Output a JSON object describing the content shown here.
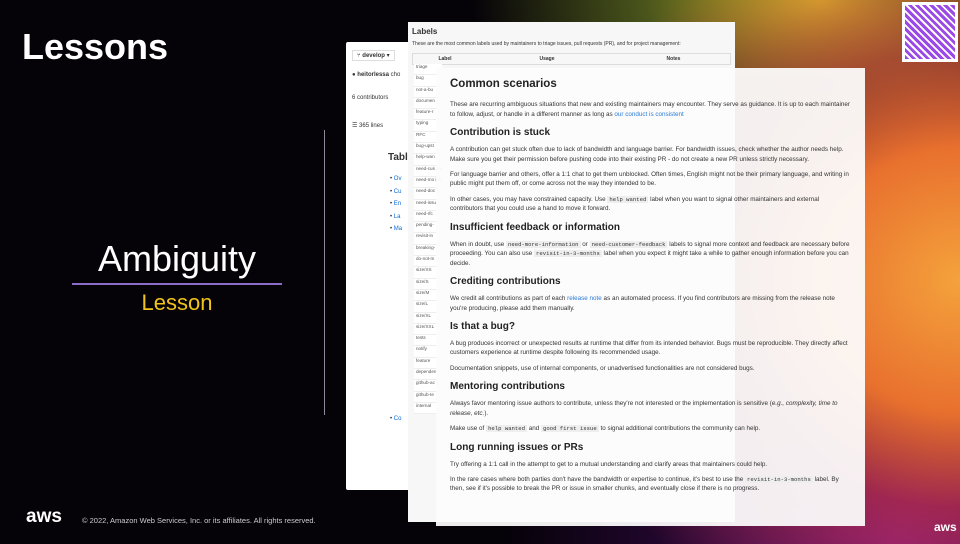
{
  "slide": {
    "title": "Lessons",
    "topic": "Ambiguity",
    "subtitle": "Lesson",
    "copyright": "© 2022, Amazon Web Services, Inc. or its affiliates. All rights reserved.",
    "aws_logo": "aws"
  },
  "github": {
    "branch": "develop",
    "author": "heitorlessa",
    "author_suffix": "cho",
    "contributors": "6 contributors",
    "lines": "365 lines",
    "toc_title": "Table",
    "toc_items": [
      "Ov",
      "Cu",
      "En",
      "La",
      "Ma",
      "Co"
    ]
  },
  "labels": {
    "title": "Labels",
    "intro": "These are the most common labels used by maintainers to triage issues, pull requests (PR), and for project management:",
    "columns": [
      "Label",
      "Usage",
      "Notes"
    ],
    "items": [
      "triage",
      "bug",
      "not-a-bu",
      "documen",
      "feature-r",
      "typing",
      "RFC",
      "bug-upst",
      "help-wan",
      "need-cus feedback",
      "need-mo informati",
      "need-doc",
      "need-issu",
      "need-rfc",
      "pending-",
      "revisit-in",
      "breaking-",
      "do-not-m",
      "size/XS",
      "size/S",
      "size/M",
      "size/L",
      "size/XL",
      "size/XXL",
      "tests",
      "notify",
      "feature",
      "dependen",
      "github-ac",
      "github-te",
      "internal"
    ]
  },
  "doc": {
    "h_common": "Common scenarios",
    "p_common": "These are recurring ambiguous situations that new and existing maintainers may encounter. They serve as guidance. It is up to each maintainer to follow, adjust, or handle in a different manner as long as ",
    "link_conduct": "our conduct is consistent",
    "h_stuck": "Contribution is stuck",
    "p_stuck1": "A contribution can get stuck often due to lack of bandwidth and language barrier. For bandwidth issues, check whether the author needs help. Make sure you get their permission before pushing code into their existing PR - do not create a new PR unless strictly necessary.",
    "p_stuck2": "For language barrier and others, offer a 1:1 chat to get them unblocked. Often times, English might not be their primary language, and writing in public might put them off, or come across not the way they intended to be.",
    "p_stuck3a": "In other cases, you may have constrained capacity. Use ",
    "code_help": "help wanted",
    "p_stuck3b": " label when you want to signal other maintainers and external contributors that you could use a hand to move it forward.",
    "h_feedback": "Insufficient feedback or information",
    "p_fb_a": "When in doubt, use ",
    "code_nmi": "need-more-information",
    "p_fb_b": " or ",
    "code_ncf": "need-customer-feedback",
    "p_fb_c": " labels to signal more context and feedback are necessary before proceeding. You can also use ",
    "code_revisit": "revisit-in-3-months",
    "p_fb_d": " label when you expect it might take a while to gather enough information before you can decide.",
    "h_credit": "Crediting contributions",
    "p_credit_a": "We credit all contributions as part of each ",
    "link_release": "release note",
    "p_credit_b": " as an automated process. If you find contributors are missing from the release note you're producing, please add them manually.",
    "h_bug": "Is that a bug?",
    "p_bug1": "A bug produces incorrect or unexpected results at runtime that differ from its intended behavior. Bugs must be reproducible. They directly affect customers experience at runtime despite following its recommended usage.",
    "p_bug2": "Documentation snippets, use of internal components, or unadvertised functionalities are not considered bugs.",
    "h_mentor": "Mentoring contributions",
    "p_mentor1a": "Always favor mentoring issue authors to contribute, unless they're not interested or the implementation is sensitive (",
    "p_mentor1_em": "e.g., complexity, time to release, etc.",
    "p_mentor1b": ").",
    "p_mentor2a": "Make use of ",
    "code_gfi": "good first issue",
    "p_mentor2b": " and ",
    "p_mentor2c": " to signal additional contributions the community can help.",
    "h_long": "Long running issues or PRs",
    "p_long1": "Try offering a 1:1 call in the attempt to get to a mutual understanding and clarify areas that maintainers could help.",
    "p_long2a": "In the rare cases where both parties don't have the bandwidth or expertise to continue, it's best to use the ",
    "p_long2b": " label. By then, see if it's possible to break the PR or issue in smaller chunks, and eventually close if there is no progress."
  }
}
